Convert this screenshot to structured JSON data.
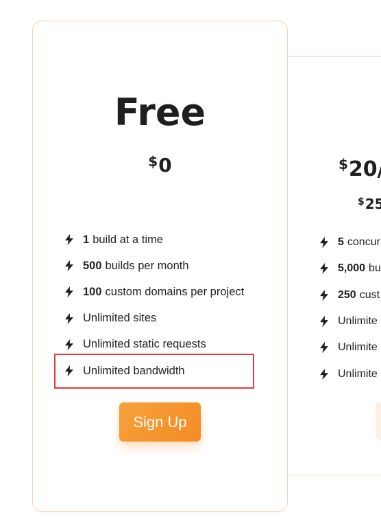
{
  "plans": [
    {
      "name": "Free",
      "price_symbol": "$",
      "price_value": "0",
      "features": [
        {
          "bold": "1",
          "text": "build at a time"
        },
        {
          "bold": "500",
          "text": "builds per month"
        },
        {
          "bold": "100",
          "text": "custom domains per project"
        },
        {
          "bold": "",
          "text": "Unlimited sites"
        },
        {
          "bold": "",
          "text": "Unlimited static requests"
        },
        {
          "bold": "",
          "text": "Unlimited bandwidth"
        }
      ],
      "cta_label": "Sign Up"
    },
    {
      "price_symbol": "$",
      "price_value": "20/",
      "subprice_symbol": "$",
      "subprice_value": "25",
      "features": [
        {
          "bold": "5",
          "text": "concur"
        },
        {
          "bold": "5,000",
          "text": "bu"
        },
        {
          "bold": "250",
          "text": "cust"
        },
        {
          "bold": "",
          "text": "Unlimite"
        },
        {
          "bold": "",
          "text": "Unlimite"
        },
        {
          "bold": "",
          "text": "Unlimite"
        }
      ]
    }
  ],
  "colors": {
    "accent": "#f48a24",
    "accent_light": "#f7a23c",
    "card_border": "#fbd1ab",
    "highlight": "#e23a3a",
    "text": "#1f1f1f"
  },
  "icons": {
    "feature": "lightning-bolt-icon"
  }
}
